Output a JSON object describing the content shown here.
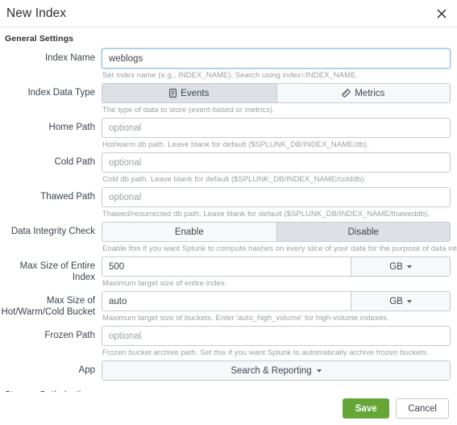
{
  "modal": {
    "title": "New Index",
    "close_icon": "close-icon"
  },
  "sections": {
    "general": "General Settings",
    "storage": "Storage Optimization"
  },
  "fields": {
    "index_name": {
      "label": "Index Name",
      "value": "weblogs",
      "hint": "Set index name (e.g., INDEX_NAME). Search using index=INDEX_NAME."
    },
    "index_data_type": {
      "label": "Index Data Type",
      "options": [
        {
          "label": "Events",
          "icon": "events-icon",
          "selected": true
        },
        {
          "label": "Metrics",
          "icon": "metrics-icon",
          "selected": false
        }
      ],
      "hint": "The type of data to store (event-based or metrics)."
    },
    "home_path": {
      "label": "Home Path",
      "value": "",
      "placeholder": "optional",
      "hint": "Hot/warm db path. Leave blank for default ($SPLUNK_DB/INDEX_NAME/db)."
    },
    "cold_path": {
      "label": "Cold Path",
      "value": "",
      "placeholder": "optional",
      "hint": "Cold db path. Leave blank for default ($SPLUNK_DB/INDEX_NAME/colddb)."
    },
    "thawed_path": {
      "label": "Thawed Path",
      "value": "",
      "placeholder": "optional",
      "hint": "Thawed/resurrected db path. Leave blank for default ($SPLUNK_DB/INDEX_NAME/thaweddb)."
    },
    "data_integrity_check": {
      "label": "Data Integrity Check",
      "options": [
        {
          "label": "Enable",
          "selected": false
        },
        {
          "label": "Disable",
          "selected": true
        }
      ],
      "hint": "Enable this if you want Splunk to compute hashes on every slice of your data for the purpose of data integrity."
    },
    "max_size_index": {
      "label": "Max Size of Entire Index",
      "value": "500",
      "unit": "GB",
      "hint": "Maximum target size of entire index."
    },
    "max_size_bucket": {
      "label": "Max Size of Hot/Warm/Cold Bucket",
      "label_line1": "Max Size of",
      "label_line2": "Hot/Warm/Cold Bucket",
      "value": "auto",
      "unit": "GB",
      "hint": "Maximum target size of buckets. Enter 'auto_high_volume' for high-volume indexes."
    },
    "frozen_path": {
      "label": "Frozen Path",
      "value": "",
      "placeholder": "optional",
      "hint": "Frozen bucket archive path. Set this if you want Splunk to automatically archive frozen buckets."
    },
    "app": {
      "label": "App",
      "value": "Search & Reporting"
    }
  },
  "footer": {
    "save_label": "Save",
    "cancel_label": "Cancel"
  },
  "colors": {
    "accent_green": "#65a637",
    "focus_blue": "#93c4ea",
    "border": "#c3cbd4",
    "text": "#3c444d",
    "hint": "#9aa0a6",
    "segment_active": "#dde1e5"
  }
}
